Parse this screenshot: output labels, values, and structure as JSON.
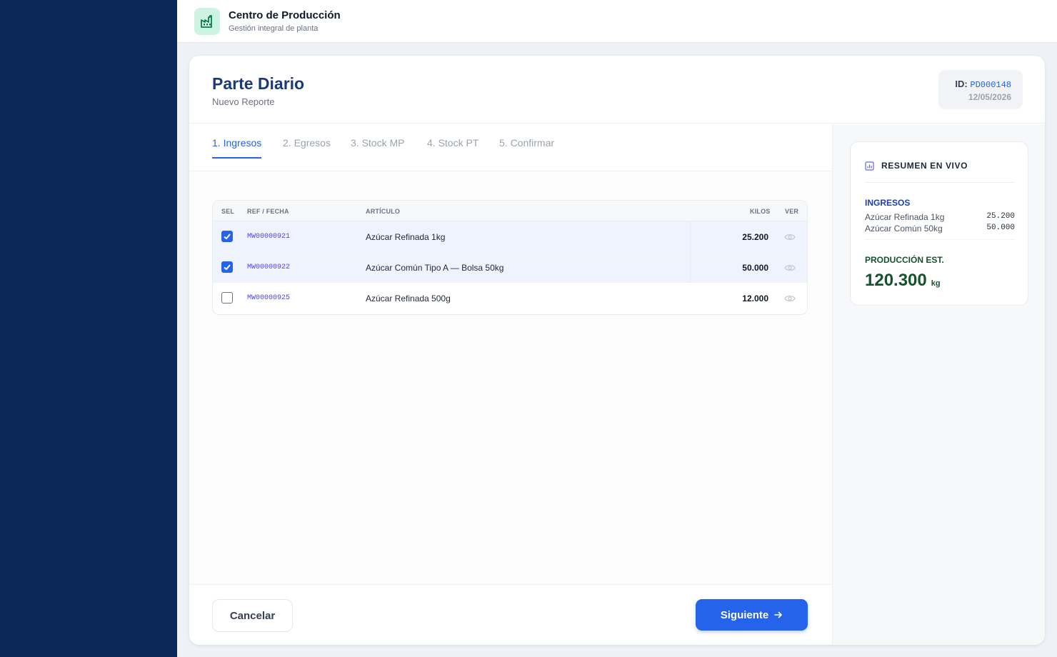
{
  "app": {
    "title": "Centro de Producción",
    "subtitle": "Gestión integral de planta",
    "accent": "#2563eb",
    "sidebar_color": "#0b2659"
  },
  "page": {
    "title": "Parte Diario",
    "subtitle": "Nuevo Reporte",
    "id_label": "ID:",
    "id_value": "PD000148",
    "date": "12/05/2026"
  },
  "tabs": [
    {
      "label": "1. Ingresos",
      "active": true
    },
    {
      "label": "2. Egresos",
      "active": false
    },
    {
      "label": "3. Stock MP",
      "active": false
    },
    {
      "label": "4. Stock PT",
      "active": false
    },
    {
      "label": "5. Confirmar",
      "active": false
    }
  ],
  "table": {
    "columns": {
      "sel": "SEL",
      "ref": "REF / FECHA",
      "articulo": "ARTÍCULO",
      "kilos": "KILOS",
      "ver": "VER"
    },
    "rows": [
      {
        "selected": true,
        "ref": "MW00000921",
        "articulo": "Azúcar Refinada 1kg",
        "kilos": "25.200",
        "view_icon": "eye-icon"
      },
      {
        "selected": true,
        "ref": "MW00000922",
        "articulo": "Azúcar Común Tipo A — Bolsa 50kg",
        "kilos": "50.000",
        "view_icon": "eye-icon"
      },
      {
        "selected": false,
        "ref": "MW00000925",
        "articulo": "Azúcar Refinada 500g",
        "kilos": "12.000",
        "view_icon": "eye-icon"
      }
    ]
  },
  "footer": {
    "cancel_label": "Cancelar",
    "next_label": "Siguiente"
  },
  "summary": {
    "title": "RESUMEN EN VIVO",
    "icon": "chart-icon",
    "ingresos_label": "INGRESOS",
    "ingresos_color": "#1e40af",
    "items": [
      {
        "name": "Azúcar Refinada 1kg",
        "value": "25.200"
      },
      {
        "name": "Azúcar Común 50kg",
        "value": "50.000"
      }
    ],
    "produccion_label": "PRODUCCIÓN EST.",
    "produccion_color": "#14532d",
    "produccion_value": "120.300",
    "produccion_unit": "kg"
  }
}
